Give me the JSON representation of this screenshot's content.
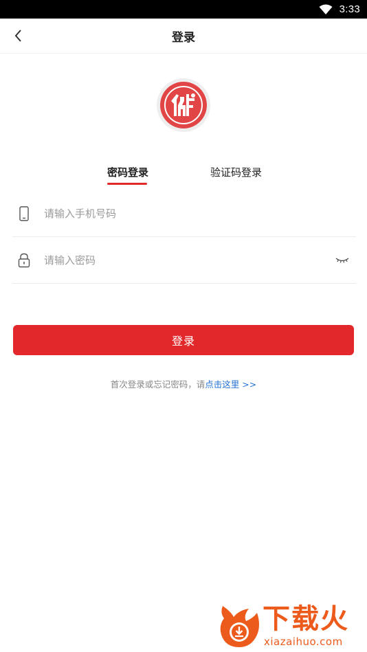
{
  "status_bar": {
    "time": "3:33"
  },
  "header": {
    "title": "登录"
  },
  "tabs": [
    {
      "label": "密码登录",
      "active": true
    },
    {
      "label": "验证码登录",
      "active": false
    }
  ],
  "form": {
    "phone": {
      "placeholder": "请输入手机号码",
      "value": ""
    },
    "password": {
      "placeholder": "请输入密码",
      "value": ""
    },
    "submit_label": "登录"
  },
  "hint": {
    "text": "首次登录或忘记密码，请",
    "link": "点击这里 >>"
  },
  "watermark": {
    "title": "下载火",
    "url": "xiazaihuo.com"
  },
  "colors": {
    "accent": "#e3282c",
    "link": "#1f6fd1",
    "watermark": "#ec5a1c"
  },
  "icons": [
    "wifi-icon",
    "back-icon",
    "app-logo",
    "phone-icon",
    "lock-icon",
    "eye-closed-icon",
    "flame-download-icon"
  ]
}
